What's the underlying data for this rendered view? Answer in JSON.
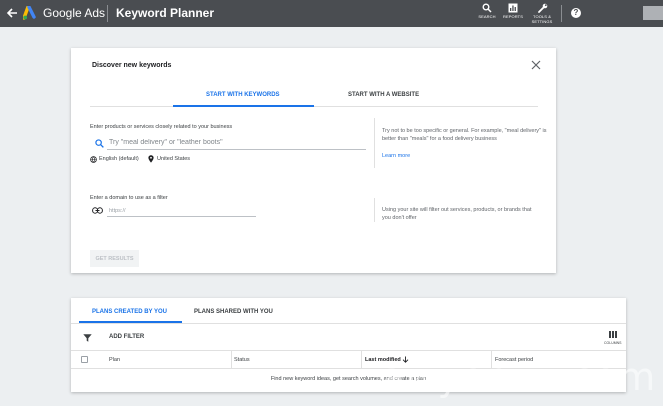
{
  "topbar": {
    "brand": "Google Ads",
    "title": "Keyword Planner",
    "search_label": "SEARCH",
    "reports_label": "REPORTS",
    "tools_label_line1": "TOOLS &",
    "tools_label_line2": "SETTINGS",
    "help_glyph": "?"
  },
  "discover": {
    "title": "Discover new keywords",
    "tabs": [
      {
        "label": "START WITH KEYWORDS",
        "active": true
      },
      {
        "label": "START WITH A WEBSITE",
        "active": false
      }
    ],
    "keywords_label": "Enter products or services closely related to your business",
    "keywords_placeholder": "Try \"meal delivery\" or \"leather boots\"",
    "language": "English (default)",
    "location": "United States",
    "keywords_help": "Try not to be too specific or general. For example, \"meal delivery\" is better than \"meals\" for a food delivery business",
    "learn_more": "Learn more",
    "domain_label": "Enter a domain to use as a filter",
    "domain_placeholder": "https://",
    "domain_help": "Using your site will filter out services, products, or brands that you don't offer",
    "get_results": "GET RESULTS"
  },
  "plans": {
    "tabs": [
      {
        "label": "PLANS CREATED BY YOU",
        "active": true
      },
      {
        "label": "PLANS SHARED WITH YOU",
        "active": false
      }
    ],
    "add_filter": "ADD FILTER",
    "columns_label": "COLUMNS",
    "columns": [
      "Plan",
      "Status",
      "Last modified",
      "Forecast period"
    ],
    "empty_message": "Find new keyword ideas, get search volumes, and create a plan"
  },
  "watermark": "awyerwu.com",
  "colors": {
    "topbar": "#4a4d51",
    "accent": "#1a73e8",
    "background": "#eceff1"
  }
}
